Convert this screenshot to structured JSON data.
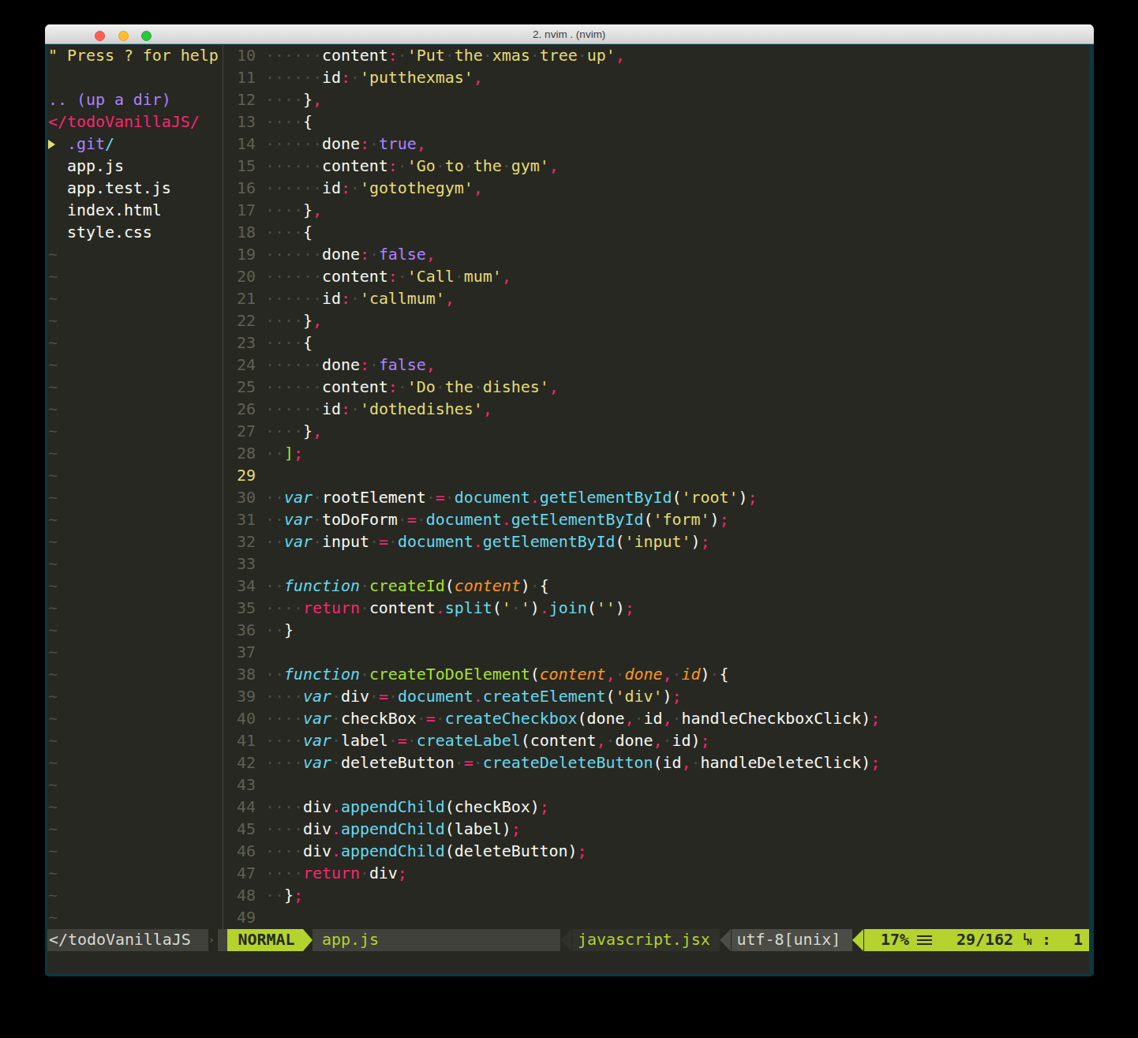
{
  "window": {
    "title": "2. nvim . (nvim)"
  },
  "titlebar_buttons": [
    "close",
    "minimize",
    "zoom"
  ],
  "sidebar": {
    "rows": [
      {
        "name": "help-hint",
        "segs": [
          [
            "y",
            "\" Press ? for help"
          ]
        ]
      },
      {
        "name": "blank",
        "segs": []
      },
      {
        "name": "up-a-dir",
        "segs": [
          [
            "v",
            ".. (up a dir)"
          ]
        ]
      },
      {
        "name": "tree-root",
        "segs": [
          [
            "r",
            "</todoVanillaJS/"
          ]
        ]
      },
      {
        "name": "dir-git",
        "segs": [
          [
            "tri",
            ""
          ],
          [
            "v",
            " .git"
          ],
          [
            "cy",
            "/"
          ]
        ]
      },
      {
        "name": "file-app-js",
        "segs": [
          [
            "w",
            "  app.js"
          ]
        ]
      },
      {
        "name": "file-app-test-js",
        "segs": [
          [
            "w",
            "  app.test.js"
          ]
        ]
      },
      {
        "name": "file-index-html",
        "segs": [
          [
            "w",
            "  index.html"
          ]
        ]
      },
      {
        "name": "file-style-css",
        "segs": [
          [
            "w",
            "  style.css"
          ]
        ]
      }
    ],
    "filler": "~",
    "filler_count": 31
  },
  "editor": {
    "first_line": 10,
    "cursor_line": 29,
    "lines": [
      {
        "n": 10,
        "segs": [
          [
            "w",
            "      content"
          ],
          [
            "p",
            ":"
          ],
          [
            "w",
            " "
          ],
          [
            "s",
            "'Put the xmas tree up'"
          ],
          [
            "p",
            ","
          ]
        ]
      },
      {
        "n": 11,
        "segs": [
          [
            "w",
            "      id"
          ],
          [
            "p",
            ":"
          ],
          [
            "w",
            " "
          ],
          [
            "s",
            "'putthexmas'"
          ],
          [
            "p",
            ","
          ]
        ]
      },
      {
        "n": 12,
        "segs": [
          [
            "w",
            "    }"
          ],
          [
            "p",
            ","
          ]
        ]
      },
      {
        "n": 13,
        "segs": [
          [
            "w",
            "    {"
          ]
        ]
      },
      {
        "n": 14,
        "segs": [
          [
            "w",
            "      done"
          ],
          [
            "p",
            ":"
          ],
          [
            "w",
            " "
          ],
          [
            "c",
            "true"
          ],
          [
            "p",
            ","
          ]
        ]
      },
      {
        "n": 15,
        "segs": [
          [
            "w",
            "      content"
          ],
          [
            "p",
            ":"
          ],
          [
            "w",
            " "
          ],
          [
            "s",
            "'Go to the gym'"
          ],
          [
            "p",
            ","
          ]
        ]
      },
      {
        "n": 16,
        "segs": [
          [
            "w",
            "      id"
          ],
          [
            "p",
            ":"
          ],
          [
            "w",
            " "
          ],
          [
            "s",
            "'gotothegym'"
          ],
          [
            "p",
            ","
          ]
        ]
      },
      {
        "n": 17,
        "segs": [
          [
            "w",
            "    }"
          ],
          [
            "p",
            ","
          ]
        ]
      },
      {
        "n": 18,
        "segs": [
          [
            "w",
            "    {"
          ]
        ]
      },
      {
        "n": 19,
        "segs": [
          [
            "w",
            "      done"
          ],
          [
            "p",
            ":"
          ],
          [
            "w",
            " "
          ],
          [
            "c",
            "false"
          ],
          [
            "p",
            ","
          ]
        ]
      },
      {
        "n": 20,
        "segs": [
          [
            "w",
            "      content"
          ],
          [
            "p",
            ":"
          ],
          [
            "w",
            " "
          ],
          [
            "s",
            "'Call mum'"
          ],
          [
            "p",
            ","
          ]
        ]
      },
      {
        "n": 21,
        "segs": [
          [
            "w",
            "      id"
          ],
          [
            "p",
            ":"
          ],
          [
            "w",
            " "
          ],
          [
            "s",
            "'callmum'"
          ],
          [
            "p",
            ","
          ]
        ]
      },
      {
        "n": 22,
        "segs": [
          [
            "w",
            "    }"
          ],
          [
            "p",
            ","
          ]
        ]
      },
      {
        "n": 23,
        "segs": [
          [
            "w",
            "    {"
          ]
        ]
      },
      {
        "n": 24,
        "segs": [
          [
            "w",
            "      done"
          ],
          [
            "p",
            ":"
          ],
          [
            "w",
            " "
          ],
          [
            "c",
            "false"
          ],
          [
            "p",
            ","
          ]
        ]
      },
      {
        "n": 25,
        "segs": [
          [
            "w",
            "      content"
          ],
          [
            "p",
            ":"
          ],
          [
            "w",
            " "
          ],
          [
            "s",
            "'Do the dishes'"
          ],
          [
            "p",
            ","
          ]
        ]
      },
      {
        "n": 26,
        "segs": [
          [
            "w",
            "      id"
          ],
          [
            "p",
            ":"
          ],
          [
            "w",
            " "
          ],
          [
            "s",
            "'dothedishes'"
          ],
          [
            "p",
            ","
          ]
        ]
      },
      {
        "n": 27,
        "segs": [
          [
            "w",
            "    }"
          ],
          [
            "p",
            ","
          ]
        ]
      },
      {
        "n": 28,
        "segs": [
          [
            "w",
            "  "
          ],
          [
            "f",
            "]"
          ],
          [
            "p",
            ";"
          ]
        ]
      },
      {
        "n": 29,
        "segs": []
      },
      {
        "n": 30,
        "segs": [
          [
            "w",
            "  "
          ],
          [
            "k",
            "var"
          ],
          [
            "w",
            " rootElement "
          ],
          [
            "p",
            "="
          ],
          [
            "w",
            " "
          ],
          [
            "b",
            "document"
          ],
          [
            "p",
            "."
          ],
          [
            "b",
            "getElementById"
          ],
          [
            "w",
            "("
          ],
          [
            "s",
            "'root'"
          ],
          [
            "w",
            ")"
          ],
          [
            "p",
            ";"
          ]
        ]
      },
      {
        "n": 31,
        "segs": [
          [
            "w",
            "  "
          ],
          [
            "k",
            "var"
          ],
          [
            "w",
            " toDoForm "
          ],
          [
            "p",
            "="
          ],
          [
            "w",
            " "
          ],
          [
            "b",
            "document"
          ],
          [
            "p",
            "."
          ],
          [
            "b",
            "getElementById"
          ],
          [
            "w",
            "("
          ],
          [
            "s",
            "'form'"
          ],
          [
            "w",
            ")"
          ],
          [
            "p",
            ";"
          ]
        ]
      },
      {
        "n": 32,
        "segs": [
          [
            "w",
            "  "
          ],
          [
            "k",
            "var"
          ],
          [
            "w",
            " input "
          ],
          [
            "p",
            "="
          ],
          [
            "w",
            " "
          ],
          [
            "b",
            "document"
          ],
          [
            "p",
            "."
          ],
          [
            "b",
            "getElementById"
          ],
          [
            "w",
            "("
          ],
          [
            "s",
            "'input'"
          ],
          [
            "w",
            ")"
          ],
          [
            "p",
            ";"
          ]
        ]
      },
      {
        "n": 33,
        "segs": []
      },
      {
        "n": 34,
        "segs": [
          [
            "w",
            "  "
          ],
          [
            "k",
            "function"
          ],
          [
            "w",
            " "
          ],
          [
            "f",
            "createId"
          ],
          [
            "w",
            "("
          ],
          [
            "a",
            "content"
          ],
          [
            "w",
            ") {"
          ]
        ]
      },
      {
        "n": 35,
        "segs": [
          [
            "w",
            "    "
          ],
          [
            "p",
            "return"
          ],
          [
            "w",
            " content"
          ],
          [
            "p",
            "."
          ],
          [
            "b",
            "split"
          ],
          [
            "w",
            "("
          ],
          [
            "s",
            "' '"
          ],
          [
            "w",
            ")"
          ],
          [
            "p",
            "."
          ],
          [
            "b",
            "join"
          ],
          [
            "w",
            "("
          ],
          [
            "s",
            "''"
          ],
          [
            "w",
            ")"
          ],
          [
            "p",
            ";"
          ]
        ]
      },
      {
        "n": 36,
        "segs": [
          [
            "w",
            "  }"
          ]
        ]
      },
      {
        "n": 37,
        "segs": []
      },
      {
        "n": 38,
        "segs": [
          [
            "w",
            "  "
          ],
          [
            "k",
            "function"
          ],
          [
            "w",
            " "
          ],
          [
            "f",
            "createToDoElement"
          ],
          [
            "w",
            "("
          ],
          [
            "a",
            "content"
          ],
          [
            "p",
            ","
          ],
          [
            "w",
            " "
          ],
          [
            "a",
            "done"
          ],
          [
            "p",
            ","
          ],
          [
            "w",
            " "
          ],
          [
            "a",
            "id"
          ],
          [
            "w",
            ") {"
          ]
        ]
      },
      {
        "n": 39,
        "segs": [
          [
            "w",
            "    "
          ],
          [
            "k",
            "var"
          ],
          [
            "w",
            " div "
          ],
          [
            "p",
            "="
          ],
          [
            "w",
            " "
          ],
          [
            "b",
            "document"
          ],
          [
            "p",
            "."
          ],
          [
            "b",
            "createElement"
          ],
          [
            "w",
            "("
          ],
          [
            "s",
            "'div'"
          ],
          [
            "w",
            ")"
          ],
          [
            "p",
            ";"
          ]
        ]
      },
      {
        "n": 40,
        "segs": [
          [
            "w",
            "    "
          ],
          [
            "k",
            "var"
          ],
          [
            "w",
            " checkBox "
          ],
          [
            "p",
            "="
          ],
          [
            "w",
            " "
          ],
          [
            "b",
            "createCheckbox"
          ],
          [
            "w",
            "(done"
          ],
          [
            "p",
            ","
          ],
          [
            "w",
            " id"
          ],
          [
            "p",
            ","
          ],
          [
            "w",
            " handleCheckboxClick)"
          ],
          [
            "p",
            ";"
          ]
        ]
      },
      {
        "n": 41,
        "segs": [
          [
            "w",
            "    "
          ],
          [
            "k",
            "var"
          ],
          [
            "w",
            " label "
          ],
          [
            "p",
            "="
          ],
          [
            "w",
            " "
          ],
          [
            "b",
            "createLabel"
          ],
          [
            "w",
            "(content"
          ],
          [
            "p",
            ","
          ],
          [
            "w",
            " done"
          ],
          [
            "p",
            ","
          ],
          [
            "w",
            " id)"
          ],
          [
            "p",
            ";"
          ]
        ]
      },
      {
        "n": 42,
        "segs": [
          [
            "w",
            "    "
          ],
          [
            "k",
            "var"
          ],
          [
            "w",
            " deleteButton "
          ],
          [
            "p",
            "="
          ],
          [
            "w",
            " "
          ],
          [
            "b",
            "createDeleteButton"
          ],
          [
            "w",
            "(id"
          ],
          [
            "p",
            ","
          ],
          [
            "w",
            " handleDeleteClick)"
          ],
          [
            "p",
            ";"
          ]
        ]
      },
      {
        "n": 43,
        "segs": []
      },
      {
        "n": 44,
        "segs": [
          [
            "w",
            "    div"
          ],
          [
            "p",
            "."
          ],
          [
            "b",
            "appendChild"
          ],
          [
            "w",
            "(checkBox)"
          ],
          [
            "p",
            ";"
          ]
        ]
      },
      {
        "n": 45,
        "segs": [
          [
            "w",
            "    div"
          ],
          [
            "p",
            "."
          ],
          [
            "b",
            "appendChild"
          ],
          [
            "w",
            "(label)"
          ],
          [
            "p",
            ";"
          ]
        ]
      },
      {
        "n": 46,
        "segs": [
          [
            "w",
            "    div"
          ],
          [
            "p",
            "."
          ],
          [
            "b",
            "appendChild"
          ],
          [
            "w",
            "(deleteButton)"
          ],
          [
            "p",
            ";"
          ]
        ]
      },
      {
        "n": 47,
        "segs": [
          [
            "w",
            "    "
          ],
          [
            "p",
            "return"
          ],
          [
            "w",
            " div"
          ],
          [
            "p",
            ";"
          ]
        ]
      },
      {
        "n": 48,
        "segs": [
          [
            "w",
            "  }"
          ],
          [
            "p",
            ";"
          ]
        ]
      },
      {
        "n": 49,
        "segs": []
      }
    ]
  },
  "statusline": {
    "tree_file": "</todoVanillaJS",
    "mode": "NORMAL",
    "filename": "app.js",
    "filetype": "javascript.jsx",
    "encoding": "utf-8[unix]",
    "percent": "17%",
    "lines_icon": "≡",
    "position_icon": "LN",
    "tree_separator": "›",
    "position": "29/162",
    "colon": ":",
    "column": "1"
  },
  "colors": {
    "terminal_padding": "#0c3842",
    "editor_bg": "#272822",
    "foreground": "#f8f8f2",
    "string_yellow": "#e6db74",
    "punct_pink": "#f92672",
    "keyword_cyan": "#66d9ef",
    "func_green": "#a6e22e",
    "const_purple": "#ae81ff",
    "arg_orange": "#fd971f",
    "lime_accent": "#b4d32e",
    "status_grey": "#40413b"
  }
}
